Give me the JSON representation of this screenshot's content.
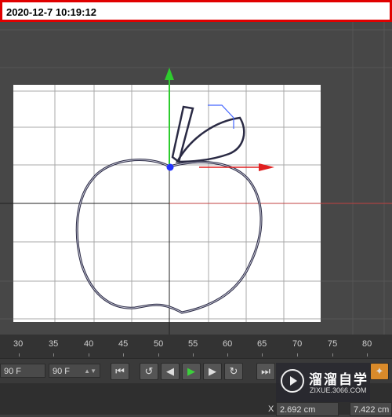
{
  "timestamp": "2020-12-7 10:19:12",
  "ruler": {
    "labels": [
      "30",
      "35",
      "40",
      "45",
      "50",
      "55",
      "60",
      "65",
      "70",
      "75",
      "80"
    ]
  },
  "transport": {
    "frame_left": "90 F",
    "frame_right": "90 F",
    "buttons": [
      "go-start",
      "prev-key",
      "prev-frame",
      "play",
      "next-frame",
      "next-key",
      "go-end"
    ]
  },
  "coords": {
    "x_label": "X",
    "x_value": "2.692 cm",
    "y_value": "7.422 cm"
  },
  "watermark": {
    "title": "溜溜自学",
    "url": "ZIXUE.3066.COM"
  },
  "colors": {
    "axis_y": "#2ecc2e",
    "axis_x": "#e02020",
    "pivot": "#2233ff",
    "timestamp_border": "#e00000"
  }
}
